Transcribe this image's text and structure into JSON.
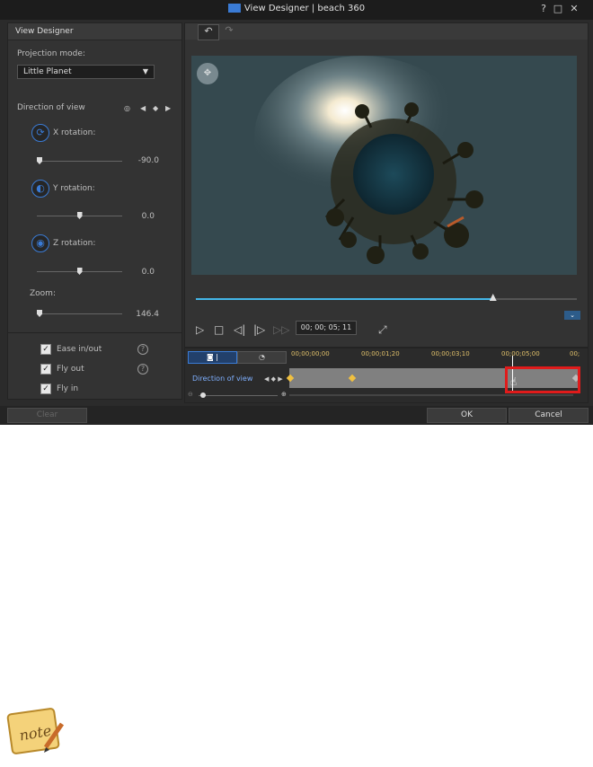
{
  "window": {
    "title": "View Designer | beach 360",
    "controls": [
      "?",
      "□",
      "✕"
    ]
  },
  "left_panel": {
    "header": "View Designer",
    "projection_label": "Projection mode:",
    "projection_value": "Little Planet",
    "direction_label": "Direction of view",
    "x_label": "X rotation:",
    "x_value": "-90.0",
    "x_level": 0.0,
    "y_label": "Y rotation:",
    "y_value": "0.0",
    "y_level": 0.5,
    "z_label": "Z rotation:",
    "z_value": "0.0",
    "z_level": 0.5,
    "zoom_label": "Zoom:",
    "zoom_value": "146.4",
    "zoom_level": 0.0,
    "ease_label": "Ease in/out",
    "fly_out_label": "Fly out",
    "fly_in_label": "Fly in"
  },
  "toolbar": {
    "undo_icon": "undo-icon",
    "redo_icon": "redo-icon"
  },
  "player": {
    "timecode": "00; 00; 05; 11",
    "progress": 0.78
  },
  "timeline": {
    "ruler": [
      "00;00;00;00",
      "00;00;01;20",
      "00;00;03;10",
      "00;00;05;00",
      "00;"
    ],
    "track_label": "Direction of view"
  },
  "footer": {
    "clear": "Clear",
    "ok": "OK",
    "cancel": "Cancel"
  },
  "note": {
    "label": "note"
  }
}
